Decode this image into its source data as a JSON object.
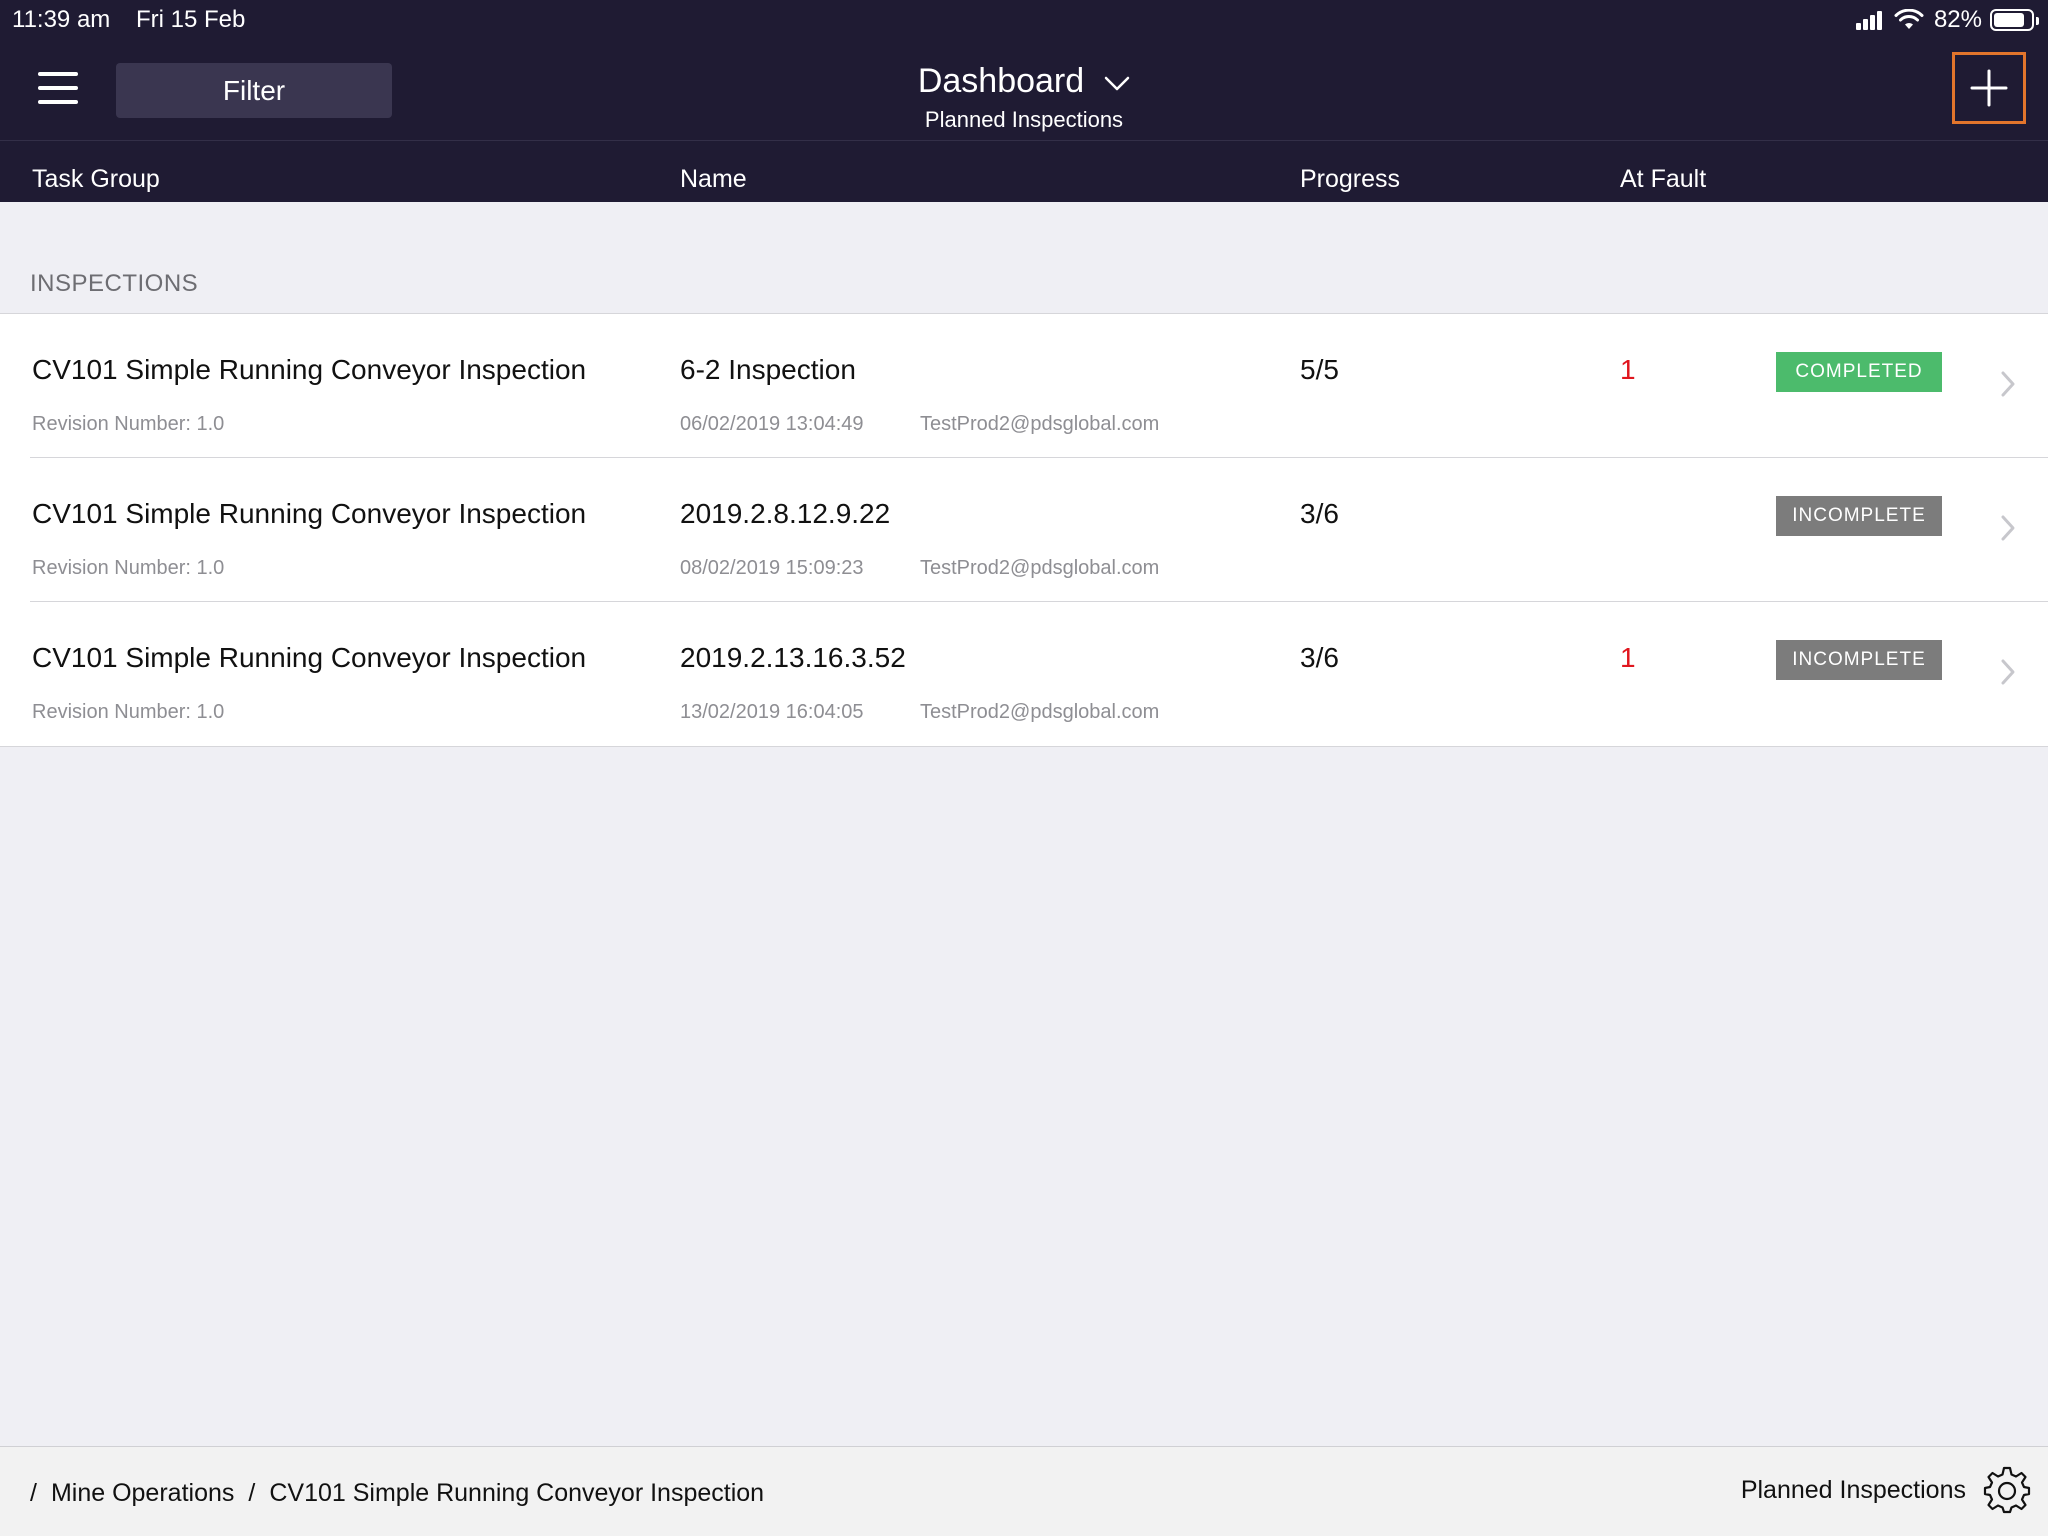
{
  "status_bar": {
    "time": "11:39 am",
    "date": "Fri 15 Feb",
    "battery": "82%",
    "battery_level": 0.82
  },
  "nav": {
    "filter_label": "Filter",
    "title": "Dashboard",
    "subtitle": "Planned Inspections",
    "icons": {
      "menu": "menu-icon",
      "title_dropdown": "chevron-down-icon",
      "add": "plus-icon"
    },
    "add_button_border_color": "#e2752c"
  },
  "columns": {
    "task_group": "Task Group",
    "name": "Name",
    "progress": "Progress",
    "at_fault": "At Fault"
  },
  "section": {
    "title": "INSPECTIONS"
  },
  "rows": [
    {
      "task_group": "CV101 Simple Running Conveyor Inspection",
      "revision": "Revision Number: 1.0",
      "name": "6-2 Inspection",
      "datetime": "06/02/2019 13:04:49",
      "email": "TestProd2@pdsglobal.com",
      "progress": "5/5",
      "at_fault": "1",
      "status": "COMPLETED",
      "status_color": "#4cbb6c"
    },
    {
      "task_group": "CV101 Simple Running Conveyor Inspection",
      "revision": "Revision Number: 1.0",
      "name": "2019.2.8.12.9.22",
      "datetime": "08/02/2019 15:09:23",
      "email": "TestProd2@pdsglobal.com",
      "progress": "3/6",
      "at_fault": "",
      "status": "INCOMPLETE",
      "status_color": "#7c7c7c"
    },
    {
      "task_group": "CV101 Simple Running Conveyor Inspection",
      "revision": "Revision Number: 1.0",
      "name": "2019.2.13.16.3.52",
      "datetime": "13/02/2019 16:04:05",
      "email": "TestProd2@pdsglobal.com",
      "progress": "3/6",
      "at_fault": "1",
      "status": "INCOMPLETE",
      "status_color": "#7c7c7c"
    }
  ],
  "footer": {
    "breadcrumb_separator": "/",
    "breadcrumb": [
      "Mine Operations",
      "CV101 Simple Running Conveyor Inspection"
    ],
    "label": "Planned Inspections",
    "icon": "gear-icon"
  }
}
